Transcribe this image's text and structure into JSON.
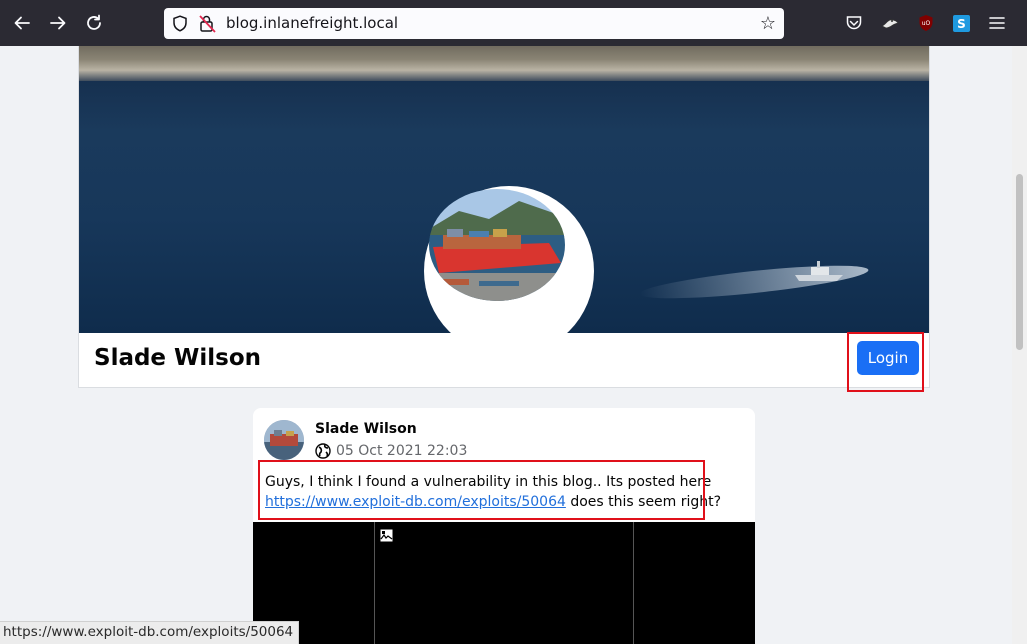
{
  "browser": {
    "url": "blog.inlanefreight.local"
  },
  "profile": {
    "name": "Slade Wilson",
    "login_label": "Login"
  },
  "post": {
    "author": "Slade Wilson",
    "timestamp": "05 Oct 2021 22:03",
    "text_before": "Guys, I think I found a vulnerability in this blog.. Its posted here ",
    "link_text": "https://www.exploit-db.com/exploits/50064",
    "text_after": " does this seem right?"
  },
  "status_bar": {
    "url": "https://www.exploit-db.com/exploits/50064"
  },
  "colors": {
    "accent": "#1a6ff5",
    "highlight": "#e0101a",
    "link": "#216fdb",
    "chrome": "#2b2a33"
  },
  "icons": [
    "back-icon",
    "forward-icon",
    "reload-icon",
    "shield-icon",
    "lock-warning-icon",
    "star-icon",
    "pocket-icon",
    "extension-icon",
    "ublock-icon",
    "s-extension-icon",
    "menu-icon",
    "globe-icon",
    "broken-image-icon"
  ]
}
